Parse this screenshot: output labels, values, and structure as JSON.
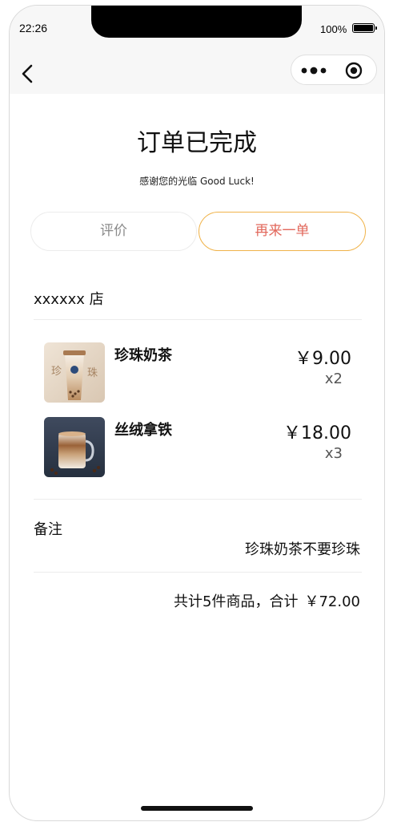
{
  "status_bar": {
    "time": "22:26",
    "battery_percent": "100%",
    "battery_level": 1.0
  },
  "nav": {
    "back_icon": "chevron-left-icon",
    "more_icon": "more-dots-icon",
    "close_icon": "target-circle-icon"
  },
  "order": {
    "title": "订单已完成",
    "subtitle": "感谢您的光临 Good Luck!",
    "review_label": "评价",
    "reorder_label": "再来一单",
    "store_name": "xxxxxx 店",
    "items": [
      {
        "name": "珍珠奶茶",
        "price": "￥9.00",
        "qty": "x2",
        "image_label_left": "珍",
        "image_label_right": "珠"
      },
      {
        "name": "丝绒拿铁",
        "price": "￥18.00",
        "qty": "x3"
      }
    ],
    "remark_label": "备注",
    "remark_text": "珍珠奶茶不要珍珠",
    "summary_count": "共计5件商品，合计",
    "summary_total": "￥72.00"
  },
  "colors": {
    "accent_border": "#f0b34a",
    "accent_text": "#e2685c",
    "muted_text": "#8a8a8a",
    "bar_background": "#f7f7f7"
  }
}
